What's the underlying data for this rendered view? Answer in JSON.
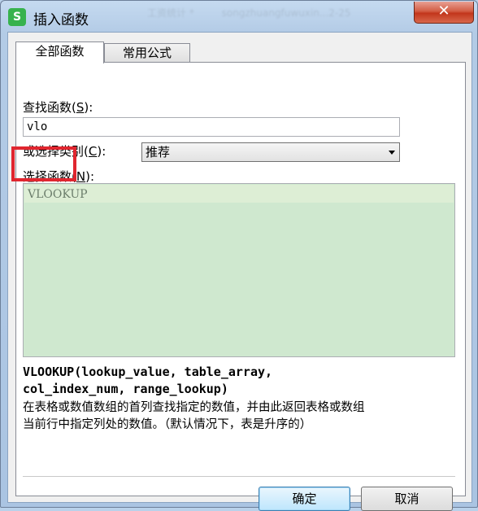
{
  "window": {
    "title": "插入函数",
    "app_icon_letter": "S",
    "background_tabs": [
      "工资统计 *",
      "songzhuangfuwuxin...2-25"
    ],
    "close_label": "✕"
  },
  "tabs": [
    {
      "label": "全部函数",
      "active": true
    },
    {
      "label": "常用公式",
      "active": false
    }
  ],
  "search": {
    "label_prefix": "查找函数(",
    "label_key": "S",
    "label_suffix": "):",
    "value": "vlo"
  },
  "category": {
    "label_prefix": "或选择类别(",
    "label_key": "C",
    "label_suffix": "):",
    "selected": "推荐"
  },
  "function_list": {
    "label_prefix": "选择函数(",
    "label_key": "N",
    "label_suffix": "):",
    "items": [
      "VLOOKUP"
    ],
    "highlight_color": "#e0262f"
  },
  "details": {
    "signature_line1": "VLOOKUP(lookup_value, table_array,",
    "signature_line2": "col_index_num, range_lookup)",
    "description_line1": "在表格或数值数组的首列查找指定的数值，并由此返回表格或数组",
    "description_line2": "当前行中指定列处的数值。（默认情况下，表是升序的）"
  },
  "buttons": {
    "ok": "确定",
    "cancel": "取消"
  }
}
